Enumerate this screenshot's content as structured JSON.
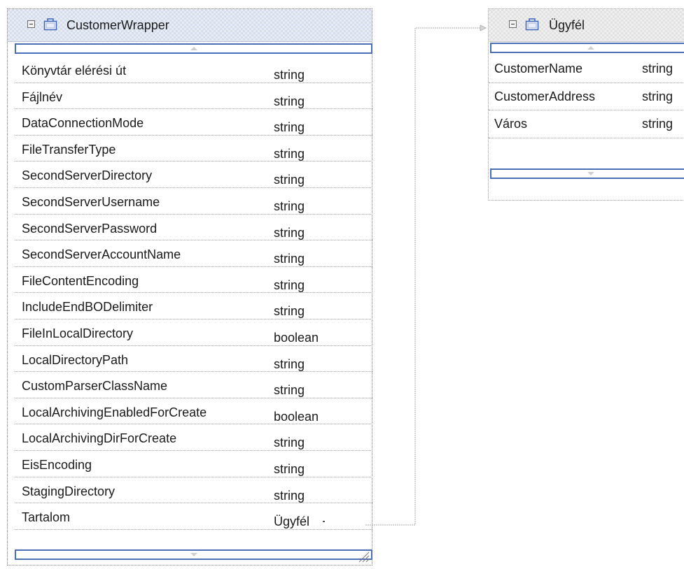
{
  "left_box": {
    "title": "CustomerWrapper",
    "rows": [
      {
        "name": "Könyvtár elérési út",
        "type": "string"
      },
      {
        "name": "Fájlnév",
        "type": "string"
      },
      {
        "name": "DataConnectionMode",
        "type": "string"
      },
      {
        "name": "FileTransferType",
        "type": "string"
      },
      {
        "name": "SecondServerDirectory",
        "type": "string"
      },
      {
        "name": "SecondServerUsername",
        "type": "string"
      },
      {
        "name": "SecondServerPassword",
        "type": "string"
      },
      {
        "name": "SecondServerAccountName",
        "type": "string"
      },
      {
        "name": "FileContentEncoding",
        "type": "string"
      },
      {
        "name": "IncludeEndBODelimiter",
        "type": "string"
      },
      {
        "name": "FileInLocalDirectory",
        "type": "boolean"
      },
      {
        "name": "LocalDirectoryPath",
        "type": "string"
      },
      {
        "name": "CustomParserClassName",
        "type": "string"
      },
      {
        "name": "LocalArchivingEnabledForCreate",
        "type": "boolean"
      },
      {
        "name": "LocalArchivingDirForCreate",
        "type": "string"
      },
      {
        "name": " EisEncoding",
        "type": "string"
      },
      {
        "name": "StagingDirectory",
        "type": "string"
      },
      {
        "name": "Tartalom",
        "type": "Ügyfél"
      }
    ]
  },
  "right_box": {
    "title": "Ügyfél",
    "rows": [
      {
        "name": "CustomerName",
        "type": "string"
      },
      {
        "name": "CustomerAddress",
        "type": "string"
      },
      {
        "name": "Város",
        "type": "string"
      }
    ]
  },
  "colors": {
    "scrollbar_border": "#4a6fb6",
    "header_blue": "#d6deed",
    "header_gray": "#e2e2e2"
  }
}
